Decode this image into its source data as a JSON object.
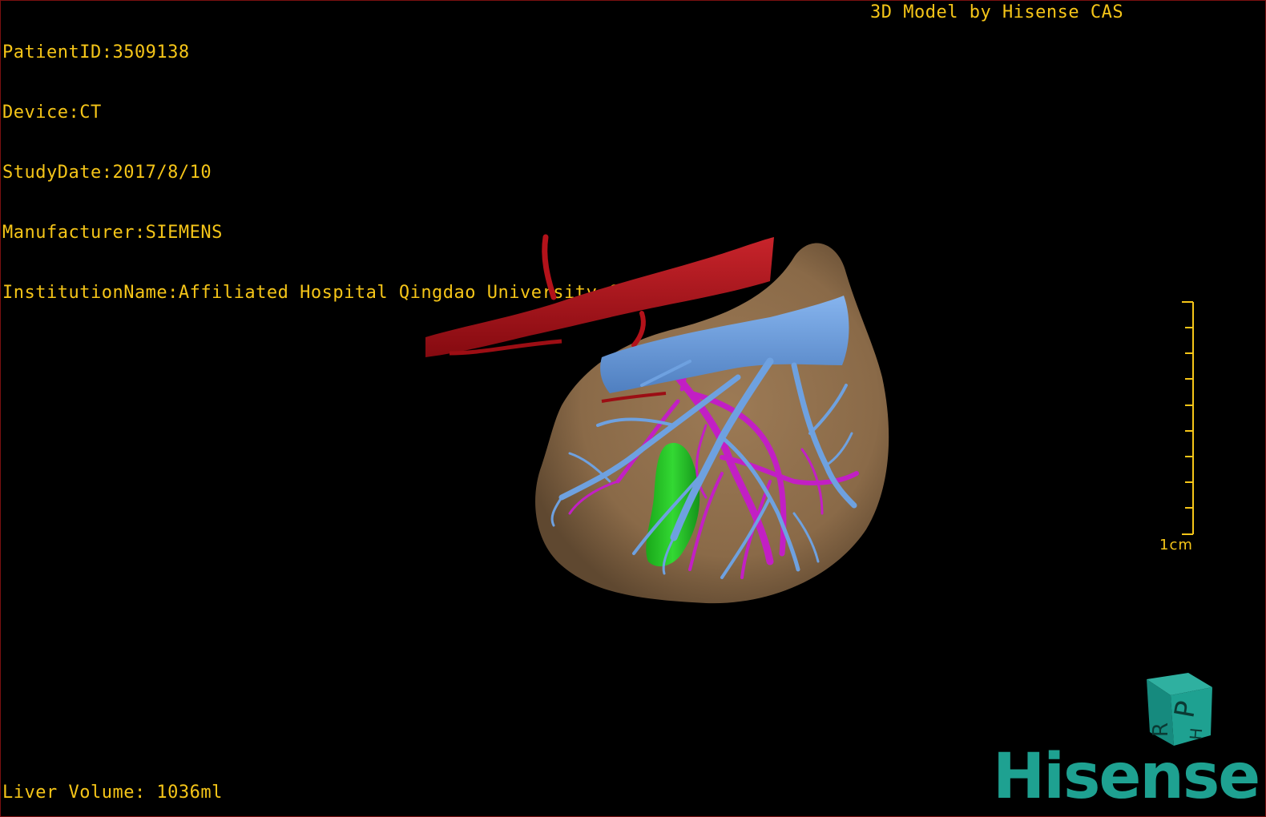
{
  "overlay": {
    "patient_id": "PatientID:3509138",
    "device": "Device:CT",
    "study_date": "StudyDate:2017/8/10",
    "manufacturer": "Manufacturer:SIEMENS",
    "institution": "InstitutionName:Affiliated Hospital Qingdao University-C",
    "model_credit": "3D Model by Hisense CAS",
    "liver_volume": "Liver Volume: 1036ml"
  },
  "scale": {
    "label": "1cm"
  },
  "orientation_cube": {
    "letters": [
      "P",
      "H",
      "R"
    ]
  },
  "brand": {
    "name": "Hisense"
  },
  "colors": {
    "overlay_text": "#f5c518",
    "liver": "#8a6a48",
    "artery": "#b3121a",
    "portal_vein": "#6ea1e0",
    "hepatic_vessels": "#c21fc4",
    "gallbladder": "#1fc41f",
    "brand": "#1ea191"
  }
}
